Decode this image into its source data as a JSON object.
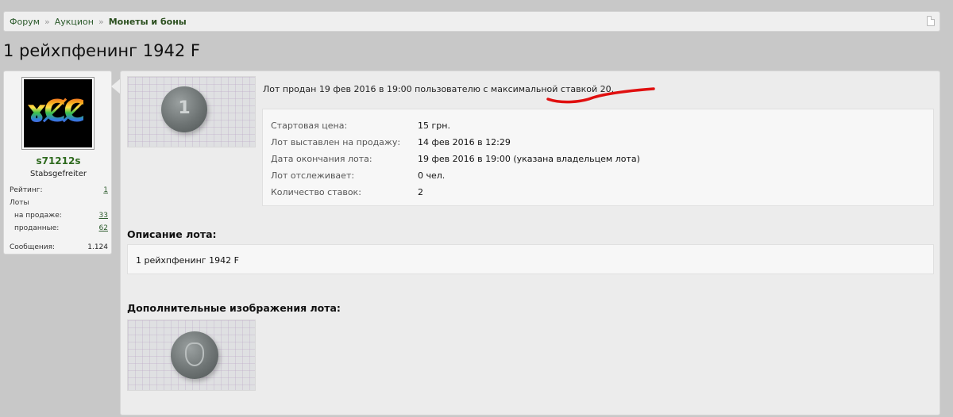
{
  "breadcrumb": [
    "Форум",
    "Аукцион",
    "Монеты и боны"
  ],
  "breadcrumb_sep": "»",
  "page_title": "1 рейхпфенинг 1942 F",
  "user": {
    "name": "s71212s",
    "title": "Stabsgefreiter",
    "stats": [
      {
        "label": "Рейтинг:",
        "value": "1"
      },
      {
        "label": "Лоты",
        "value": ""
      },
      {
        "label": "на продаже:",
        "value": "33"
      },
      {
        "label": "проданные:",
        "value": "62"
      },
      {
        "label": "Сообщения:",
        "value": "1.124"
      }
    ]
  },
  "lot": {
    "sold_text": "Лот продан 19 фев 2016 в 19:00 пользователю с максимальной ставкой 20.",
    "details": [
      {
        "label": "Стартовая цена:",
        "value": "15 грн."
      },
      {
        "label": "Лот выставлен на продажу:",
        "value": "14 фев 2016 в 12:29"
      },
      {
        "label": "Дата окончания лота:",
        "value": "19 фев 2016 в 19:00 (указана владельцем лота)"
      },
      {
        "label": "Лот отслеживает:",
        "value": "0 чел."
      },
      {
        "label": "Количество ставок:",
        "value": "2"
      }
    ],
    "description_heading": "Описание лота:",
    "description": "1 рейхпфенинг 1942 F",
    "extra_images_heading": "Дополнительные изображения лота:",
    "main_image": "coin-photo-reverse",
    "extra_image": "coin-photo-obverse"
  },
  "colors": {
    "accent_green": "#2f6a1f",
    "annotation_red": "#e01010"
  }
}
